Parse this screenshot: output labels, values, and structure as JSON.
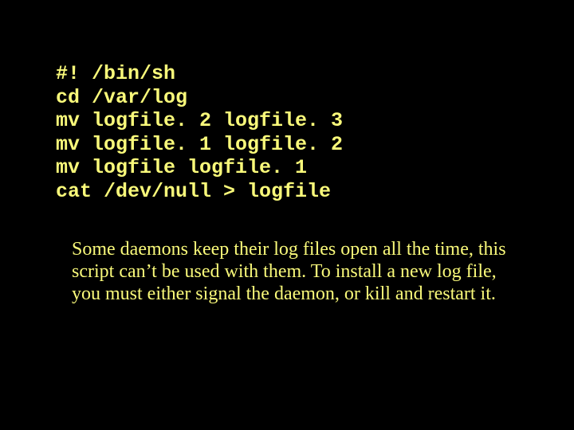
{
  "code": {
    "l0": "#! /bin/sh",
    "l1": "cd /var/log",
    "l2": "mv logfile. 2 logfile. 3",
    "l3": "mv logfile. 1 logfile. 2",
    "l4": "mv logfile logfile. 1",
    "l5": "cat /dev/null > logfile"
  },
  "paragraph": "Some daemons keep their log files open all the time, this script can’t be used with them. To install a new log file, you must either signal the daemon, or kill and restart it."
}
